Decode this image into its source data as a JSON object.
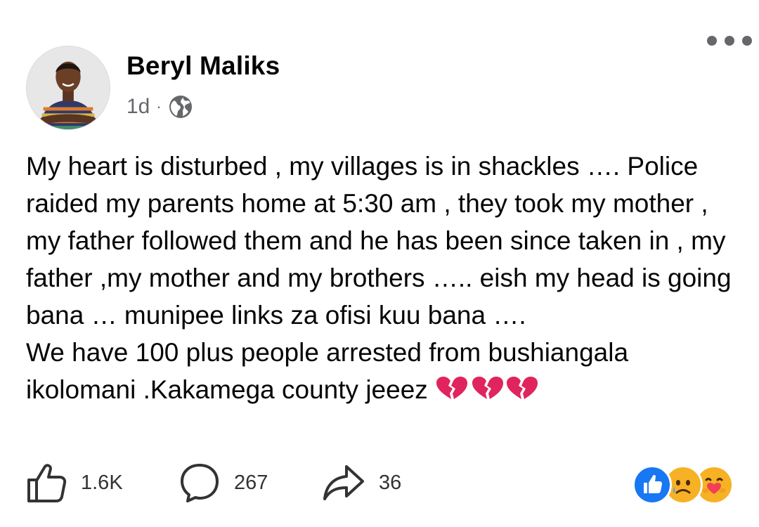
{
  "post": {
    "author": {
      "name": "Beryl Maliks",
      "avatar_icon": "profile-photo"
    },
    "meta": {
      "time": "1d",
      "separator": "·",
      "audience_icon": "globe-icon"
    },
    "more_icon": "more-options-icon",
    "text": {
      "p1": "My heart is disturbed , my villages is in shackles …. Police raided my parents home at 5:30 am , they took my mother , my father followed them and he has been since taken in , my father ,my mother and my brothers ….. eish my head is going bana … munipee links za ofisi kuu bana ….",
      "p2": "We have 100 plus people arrested from bushiangala ikolomani .Kakamega county  jeeez"
    },
    "actions": {
      "like_count": "1.6K",
      "comment_count": "267",
      "share_count": "36"
    },
    "reactions": [
      "like",
      "sad",
      "care"
    ]
  },
  "colors": {
    "text": "#050505",
    "secondary": "#65676b",
    "like_blue": "#1877f2",
    "emoji_yellow": "#f7b125",
    "broken_heart": "#e0245e"
  }
}
